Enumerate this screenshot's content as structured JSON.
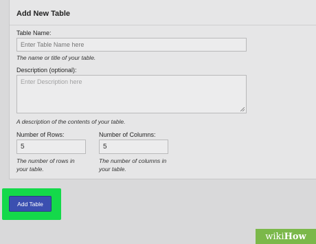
{
  "panel": {
    "title": "Add New Table"
  },
  "table_name": {
    "label": "Table Name:",
    "placeholder": "Enter Table Name here",
    "help": "The name or title of your table."
  },
  "description": {
    "label": "Description (optional):",
    "placeholder": "Enter Description here",
    "help": "A description of the contents of your table."
  },
  "rows": {
    "label": "Number of Rows:",
    "value": "5",
    "help_line1": "The number of rows in",
    "help_line2": "your table."
  },
  "columns": {
    "label": "Number of Columns:",
    "value": "5",
    "help_line1": "The number of columns in",
    "help_line2": "your table."
  },
  "actions": {
    "add_table_label": "Add Table",
    "highlight_color": "#14d94a",
    "button_color": "#3b4fb0"
  },
  "watermark": {
    "part1": "wiki",
    "part2": "How"
  }
}
